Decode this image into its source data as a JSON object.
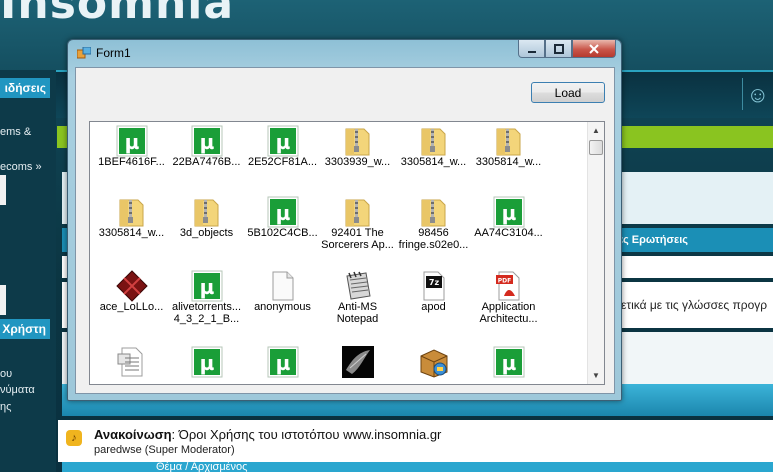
{
  "site": {
    "logo_text": "Insomnia",
    "sidebar": {
      "news_button": "ιδήσεις",
      "link_1": "ems &",
      "link_2": "ecoms »",
      "user_button": "Χρήστη",
      "menu_1": "ου",
      "menu_2": "νύματα",
      "menu_3": "ης"
    },
    "category_header": "ές Ερωτήσεις",
    "row_text": "ετικά με τις γλώσσες προγρ",
    "announcement": {
      "label": "Ανακοίνωση",
      "title": "Όροι Χρήσης του ιστοτόπου www.insomnia.gr",
      "author": "paredwse (Super Moderator)"
    },
    "bottom_bar": "Θέμα / Αρχισμένος"
  },
  "window": {
    "title": "Form1",
    "load_button": "Load",
    "colors": {
      "utorrent": "#1a9e38",
      "folder": "#f3d57a",
      "close": "#c9564a"
    },
    "items": [
      {
        "label": "1BEF4616F...",
        "icon": "utorrent-icon"
      },
      {
        "label": "22BA7476B...",
        "icon": "utorrent-icon"
      },
      {
        "label": "2E52CF81A...",
        "icon": "utorrent-icon"
      },
      {
        "label": "3303939_w...",
        "icon": "zip-folder-icon"
      },
      {
        "label": "3305814_w...",
        "icon": "zip-folder-icon"
      },
      {
        "label": "3305814_w...",
        "icon": "zip-folder-icon"
      },
      {
        "label": "3305814_w...",
        "icon": "zip-folder-icon"
      },
      {
        "label": "3d_objects",
        "icon": "zip-folder-icon"
      },
      {
        "label": "5B102C4CB...",
        "icon": "utorrent-icon"
      },
      {
        "label": "92401 The\nSorcerers Ap...",
        "icon": "zip-folder-icon"
      },
      {
        "label": "98456\nfringe.s02e0...",
        "icon": "zip-folder-icon"
      },
      {
        "label": "AA74C3104...",
        "icon": "utorrent-icon"
      },
      {
        "label": "ace_LoLLo...",
        "icon": "red-diamond-icon"
      },
      {
        "label": "alivetorrents...\n4_3_2_1_B...",
        "icon": "utorrent-icon"
      },
      {
        "label": "anonymous",
        "icon": "blank-file-icon"
      },
      {
        "label": "Anti-MS\nNotepad",
        "icon": "notepad-icon"
      },
      {
        "label": "apod",
        "icon": "7z-archive-icon"
      },
      {
        "label": "Application\nArchitectu...",
        "icon": "pdf-icon"
      },
      {
        "label": "",
        "icon": "text-document-icon"
      },
      {
        "label": "",
        "icon": "utorrent-icon"
      },
      {
        "label": "",
        "icon": "utorrent-icon"
      },
      {
        "label": "",
        "icon": "dark-image-icon"
      },
      {
        "label": "",
        "icon": "installer-box-icon"
      },
      {
        "label": "",
        "icon": "utorrent-icon"
      }
    ]
  }
}
